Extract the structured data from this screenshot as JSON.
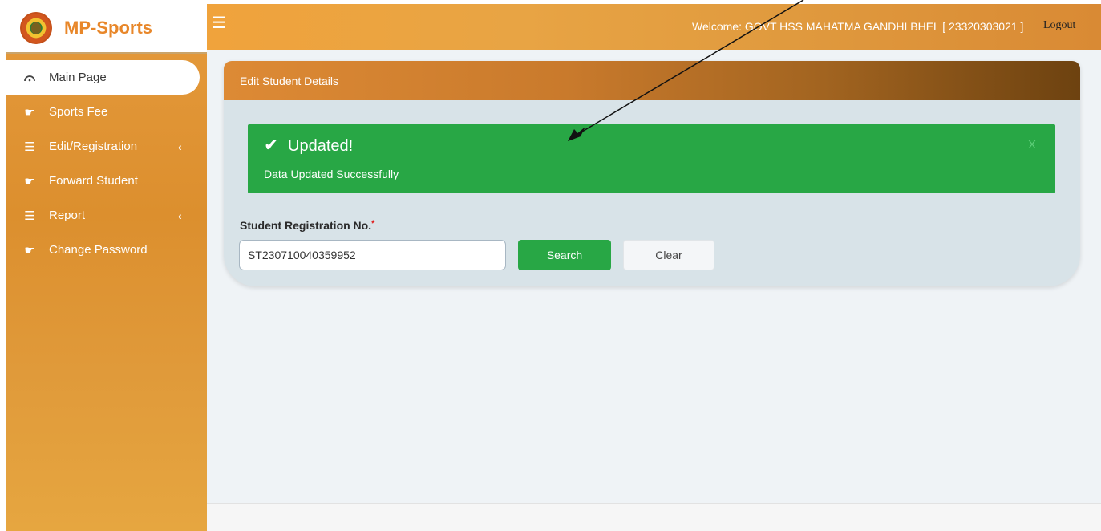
{
  "brand": {
    "name": "MP-Sports",
    "logo_icon": "mp-emblem-logo"
  },
  "sidebar": {
    "items": [
      {
        "label": "Main Page",
        "icon": "dashboard-icon",
        "active": true,
        "has_submenu": false
      },
      {
        "label": "Sports Fee",
        "icon": "hand-pointer-icon",
        "active": false,
        "has_submenu": false
      },
      {
        "label": "Edit/Registration",
        "icon": "list-icon",
        "active": false,
        "has_submenu": true
      },
      {
        "label": "Forward Student",
        "icon": "hand-pointer-icon",
        "active": false,
        "has_submenu": false
      },
      {
        "label": "Report",
        "icon": "list-icon",
        "active": false,
        "has_submenu": true
      },
      {
        "label": "Change Password",
        "icon": "hand-pointer-icon",
        "active": false,
        "has_submenu": false
      }
    ]
  },
  "header": {
    "welcome": "Welcome: GOVT HSS MAHATMA GANDHI BHEL [ 23320303021 ]",
    "logout": "Logout"
  },
  "card": {
    "title": "Edit Student Details"
  },
  "alert": {
    "title": "Updated!",
    "message": "Data Updated Successfully",
    "close": "X"
  },
  "form": {
    "label": "Student Registration No.",
    "required_mark": "*",
    "registration_no": "ST230710040359952",
    "search_label": "Search",
    "clear_label": "Clear"
  },
  "colors": {
    "accent_orange": "#e59a3c",
    "success_green": "#28a745",
    "card_bg": "#d8e3e8"
  }
}
